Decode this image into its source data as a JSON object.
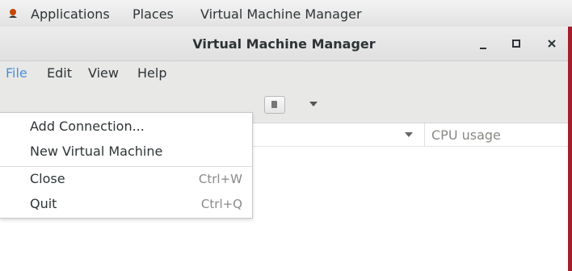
{
  "topbar": {
    "applications": "Applications",
    "places": "Places",
    "app_name": "Virtual Machine Manager"
  },
  "window": {
    "title": "Virtual Machine Manager",
    "minimize": "_",
    "maximize": "□",
    "close": "×"
  },
  "menubar": {
    "items": [
      "File",
      "Edit",
      "View",
      "Help"
    ]
  },
  "file_menu": {
    "items": [
      {
        "label": "Add Connection...",
        "accel": ""
      },
      {
        "label": "New Virtual Machine",
        "accel": ""
      },
      {
        "label": "Close",
        "accel": "Ctrl+W"
      },
      {
        "label": "Quit",
        "accel": "Ctrl+Q"
      }
    ]
  },
  "columns": {
    "cpu_usage": "CPU usage"
  },
  "colors": {
    "accent": "#4a90d9",
    "desktop_edge": "#a51d2d"
  }
}
